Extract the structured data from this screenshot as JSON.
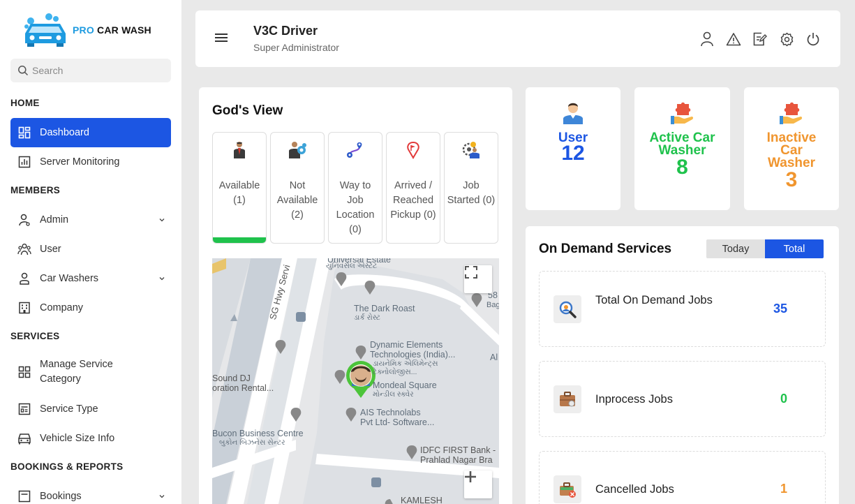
{
  "brand": {
    "pro": "PRO",
    "name": "CAR WASH"
  },
  "search": {
    "placeholder": "Search"
  },
  "sidebar": {
    "sections": [
      "HOME",
      "MEMBERS",
      "SERVICES",
      "BOOKINGS & REPORTS"
    ],
    "items": [
      {
        "label": "Dashboard",
        "icon": "dashboard-icon",
        "active": true
      },
      {
        "label": "Server Monitoring",
        "icon": "chart-icon"
      },
      {
        "label": "Admin",
        "icon": "admin-icon",
        "chevron": true
      },
      {
        "label": "User",
        "icon": "users-icon"
      },
      {
        "label": "Car Washers",
        "icon": "person-icon",
        "chevron": true
      },
      {
        "label": "Company",
        "icon": "building-icon"
      },
      {
        "label": "Manage Service Category",
        "icon": "grid-icon"
      },
      {
        "label": "Service Type",
        "icon": "list-icon"
      },
      {
        "label": "Vehicle Size Info",
        "icon": "car-icon"
      },
      {
        "label": "Bookings",
        "icon": "bookings-icon",
        "chevron": true
      }
    ]
  },
  "header": {
    "title": "V3C Driver",
    "subtitle": "Super Administrator",
    "icons": [
      "profile-icon",
      "alert-icon",
      "edit-icon",
      "settings-icon",
      "power-icon"
    ]
  },
  "gods_view": {
    "title": "God's View",
    "statuses": [
      {
        "label": "Available (1)",
        "active": true
      },
      {
        "label": "Not Available (2)"
      },
      {
        "label": "Way to Job Location (0)"
      },
      {
        "label": "Arrived / Reached Pickup (0)"
      },
      {
        "label": "Job Started (0)"
      }
    ],
    "map_labels": {
      "universal_estate": "Universal Estate",
      "universal_estate_gu": "યુનિવર્સલ એસ્ટેટ",
      "sg_hwy": "SG Hwy Servi",
      "dark_roast": "The Dark Roast",
      "dark_roast_gu": "ડાર્ક રોસ્ટ",
      "dynamic_1": "Dynamic Elements",
      "dynamic_2": "Technologies (India)...",
      "dynamic_gu_1": "ડાયનેમિક એલિમેન્ટ્સ",
      "dynamic_gu_2": "ટેક્નોલોજીસ...",
      "sound_1": "Sound DJ",
      "sound_2": "oration Rental...",
      "mondeal": "Mondeal Square",
      "mondeal_gu": "મોન્ડીલ સ્ક્વેર",
      "ais_1": "AIS Technolabs",
      "ais_2": "Pvt Ltd- Software...",
      "bucon": "Bucon Business Centre",
      "bucon_gu": "બુકોન બિઝનેસ સેન્ટર",
      "idfc_1": "IDFC FIRST Bank -",
      "idfc_2": "Prahlad Nagar Bra",
      "kamlesh": "KAMLESH",
      "edge_al": "Al",
      "edge_58": "58",
      "edge_bag": "Bag"
    }
  },
  "stats": [
    {
      "label": "User",
      "value": "12",
      "color": "#1c56e3"
    },
    {
      "label": "Active Car Washer",
      "value": "8",
      "color": "#1fc24c"
    },
    {
      "label": "Inactive Car Washer",
      "value": "3",
      "color": "#f0952e"
    }
  ],
  "on_demand": {
    "title": "On Demand Services",
    "tabs": [
      "Today",
      "Total"
    ],
    "active_tab": "Total",
    "rows": [
      {
        "label": "Total On Demand Jobs",
        "value": "35",
        "color": "#1c56e3"
      },
      {
        "label": "Inprocess Jobs",
        "value": "0",
        "color": "#1fc24c"
      },
      {
        "label": "Cancelled Jobs",
        "value": "1",
        "color": "#f0952e"
      }
    ]
  }
}
